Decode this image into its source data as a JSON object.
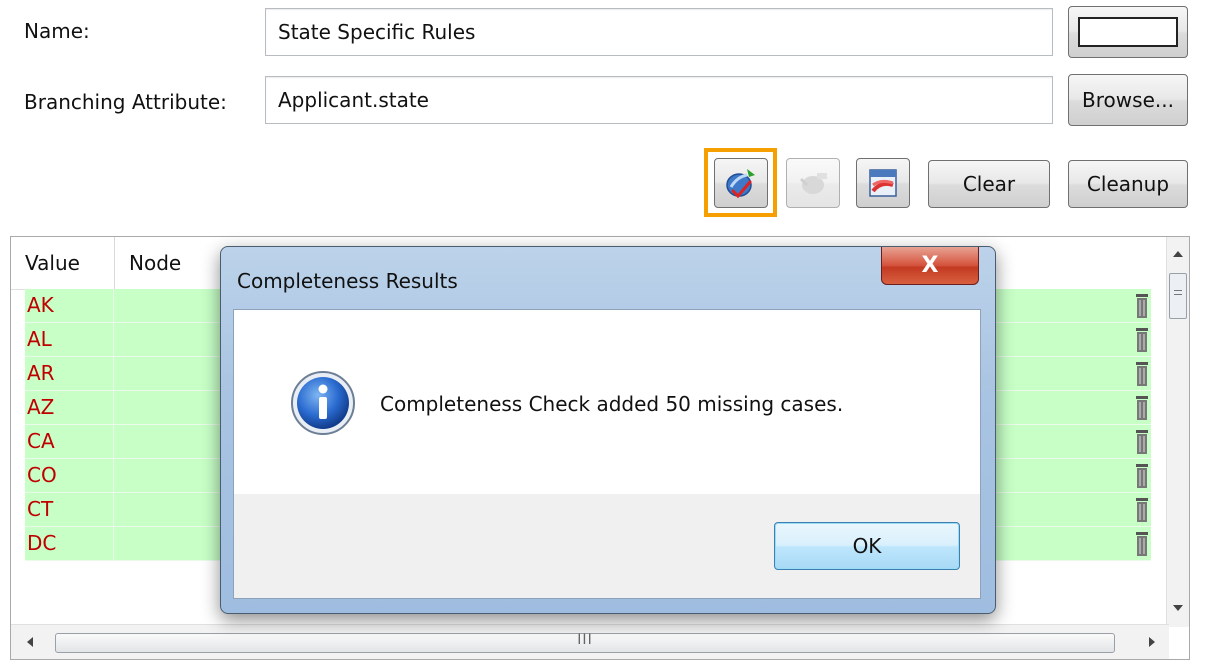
{
  "form": {
    "name_label": "Name:",
    "name_value": "State Specific Rules",
    "branching_label": "Branching Attribute:",
    "branching_value": "Applicant.state",
    "browse_label": "Browse..."
  },
  "toolbar": {
    "clear_label": "Clear",
    "cleanup_label": "Cleanup",
    "icons": [
      "completeness-check-icon",
      "disabled-tool-icon",
      "layout-tool-icon"
    ],
    "highlight_color": "#f5a000"
  },
  "table": {
    "columns": [
      "Value",
      "Node"
    ],
    "rows": [
      "AK",
      "AL",
      "AR",
      "AZ",
      "CA",
      "CO",
      "CT",
      "DC"
    ],
    "row_bg": "#c7ffc7",
    "value_color": "#c00000",
    "hscroll_grip": "III"
  },
  "dialog": {
    "title": "Completeness Results",
    "close_label": "X",
    "message": "Completeness Check added 50 missing cases.",
    "ok_label": "OK",
    "icon": "info-icon"
  }
}
